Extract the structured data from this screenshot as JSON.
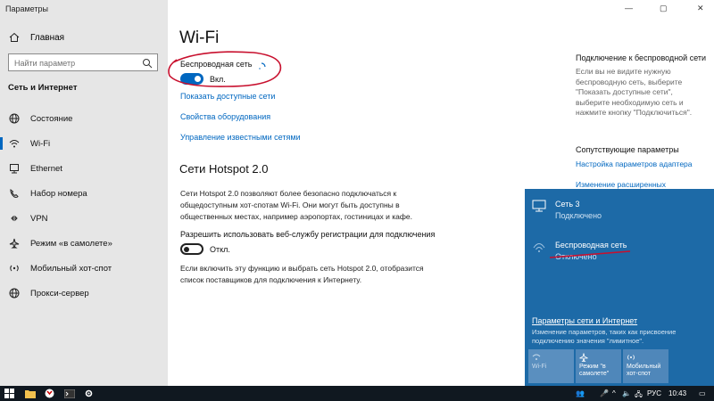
{
  "app_title": "Параметры",
  "window_controls": {
    "minimize": "—",
    "maximize": "▢",
    "close": "✕"
  },
  "sidebar": {
    "home_label": "Главная",
    "search_placeholder": "Найти параметр",
    "section_title": "Сеть и Интернет",
    "items": [
      {
        "label": "Состояние",
        "icon": "globe-icon"
      },
      {
        "label": "Wi-Fi",
        "icon": "wifi-icon",
        "active": true
      },
      {
        "label": "Ethernet",
        "icon": "ethernet-icon"
      },
      {
        "label": "Набор номера",
        "icon": "phone-icon"
      },
      {
        "label": "VPN",
        "icon": "vpn-icon"
      },
      {
        "label": "Режим «в самолете»",
        "icon": "airplane-icon"
      },
      {
        "label": "Мобильный хот-спот",
        "icon": "hotspot-icon"
      },
      {
        "label": "Прокси-сервер",
        "icon": "globe-icon"
      }
    ]
  },
  "main": {
    "title": "Wi-Fi",
    "wireless_label": "Беспроводная сеть",
    "wireless_toggle": "Вкл.",
    "links": [
      "Показать доступные сети",
      "Свойства оборудования",
      "Управление известными сетями"
    ],
    "hotspot_title": "Сети Hotspot 2.0",
    "hotspot_desc": [
      "Сети Hotspot 2.0 позволяют более безопасно подключаться к",
      "общедоступным хот-спотам Wi-Fi. Они могут быть доступны в",
      "общественных местах, например аэропортах, гостиницах и кафе."
    ],
    "hotspot_reg_label": "Разрешить использовать веб-службу регистрации для подключения",
    "hotspot_toggle": "Откл.",
    "hotspot_note": [
      "Если включить эту функцию и выбрать сеть Hotspot 2.0, отобразится",
      "список поставщиков для подключения к Интернету."
    ]
  },
  "right": {
    "title1": "Подключение к беспроводной сети",
    "text1": [
      "Если вы не видите нужную",
      "беспроводную сеть, выберите",
      "\"Показать доступные сети\",",
      "выберите необходимую сеть и",
      "нажмите кнопку \"Подключиться\"."
    ],
    "title2": "Сопутствующие параметры",
    "link1": "Настройка параметров адаптера",
    "link2": "Изменение расширенных"
  },
  "flyout": {
    "net1_name": "Сеть 3",
    "net1_status": "Подключено",
    "net2_name": "Беспроводная сеть",
    "net2_status": "Отключено",
    "settings_link": "Параметры сети и Интернет",
    "note": "Изменение параметров, таких как присвоение подключению значения \"лимитное\".",
    "tiles": [
      "Wi-Fi",
      "Режим \"в самолете\"",
      "Мобильный хот-спот"
    ]
  },
  "taskbar": {
    "lang": "РУС",
    "time": "10:43"
  },
  "colors": {
    "accent": "#0067c0",
    "flyout": "#1d6aa7",
    "annotation": "#c8102e"
  }
}
